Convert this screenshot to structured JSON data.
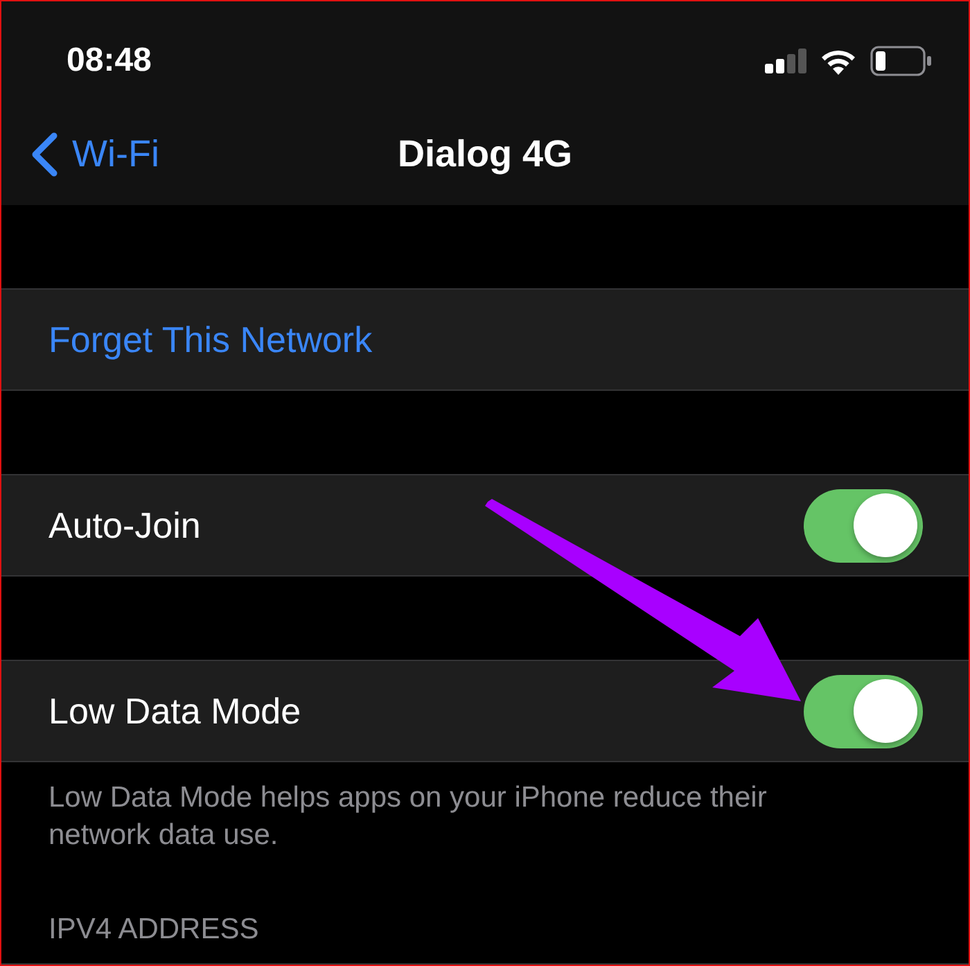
{
  "status_bar": {
    "time": "08:48"
  },
  "nav": {
    "back_label": "Wi-Fi",
    "title": "Dialog 4G"
  },
  "sections": [
    {
      "rows": [
        {
          "kind": "action",
          "label": "Forget This Network"
        }
      ]
    },
    {
      "rows": [
        {
          "kind": "toggle",
          "label": "Auto-Join",
          "on": true
        }
      ]
    },
    {
      "rows": [
        {
          "kind": "toggle",
          "label": "Low Data Mode",
          "on": true
        }
      ],
      "footer": "Low Data Mode helps apps on your iPhone reduce their network data use."
    }
  ],
  "next_section_header": "IPV4 ADDRESS"
}
